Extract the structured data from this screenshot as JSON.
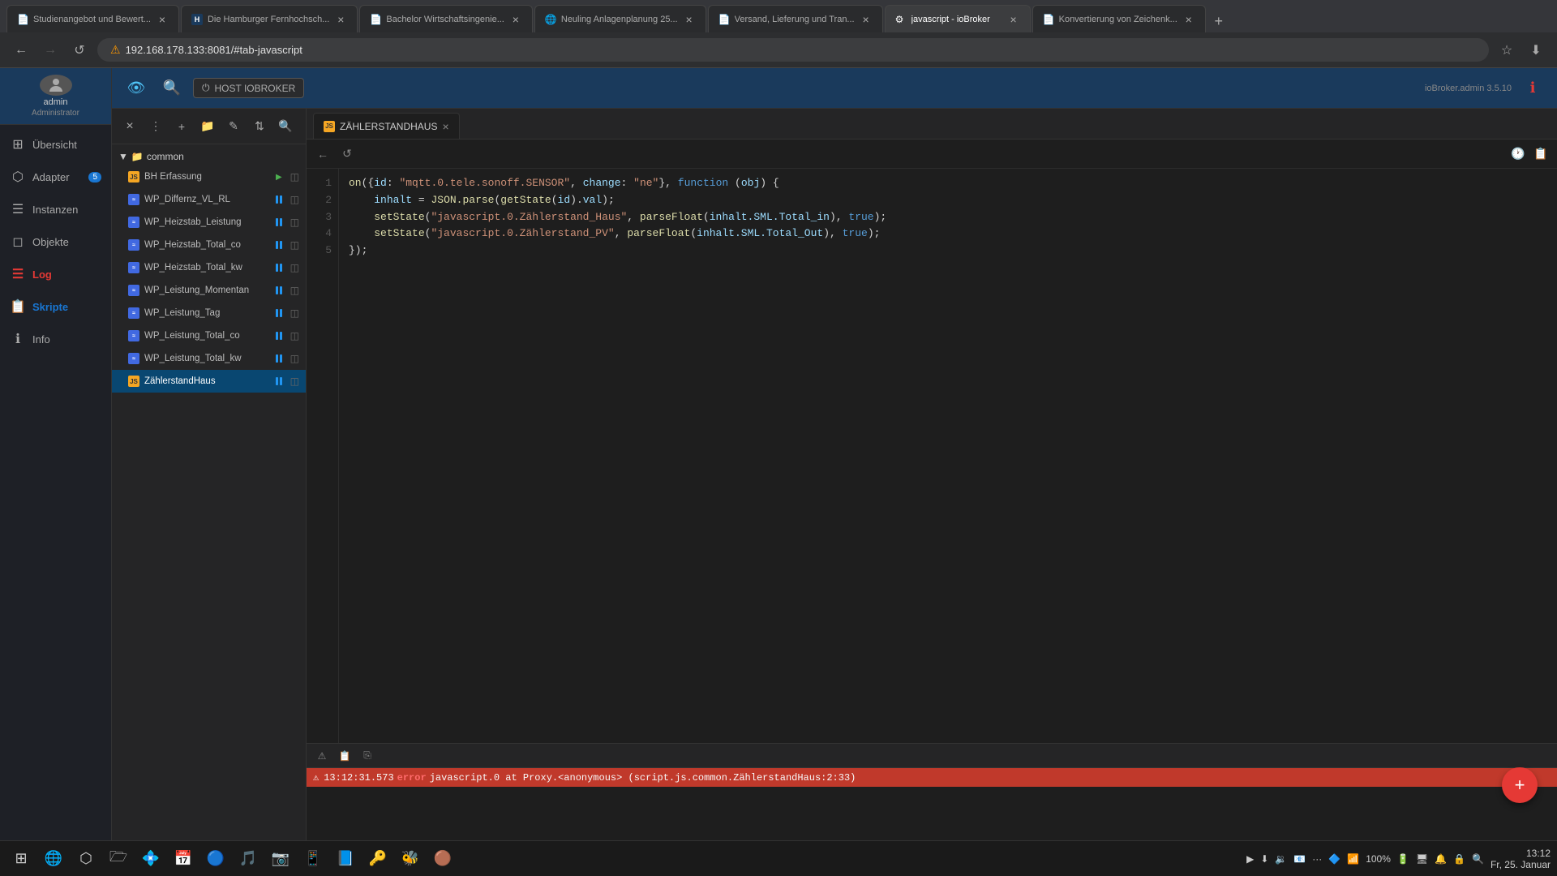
{
  "browser": {
    "tabs": [
      {
        "id": "tab-1",
        "title": "Studienangebot und Bewert...",
        "favicon": "📄",
        "active": false,
        "closable": true
      },
      {
        "id": "tab-2",
        "title": "Die Hamburger Fernhochsch...",
        "favicon": "H",
        "active": false,
        "closable": true
      },
      {
        "id": "tab-3",
        "title": "Bachelor Wirtschaftsingenie...",
        "favicon": "📄",
        "active": false,
        "closable": true
      },
      {
        "id": "tab-4",
        "title": "Neuling Anlagenplanung 25...",
        "favicon": "🌐",
        "active": false,
        "closable": true
      },
      {
        "id": "tab-5",
        "title": "Versand, Lieferung und Tran...",
        "favicon": "📄",
        "active": false,
        "closable": true
      },
      {
        "id": "tab-6",
        "title": "javascript - ioBroker",
        "favicon": "⚙",
        "active": true,
        "closable": true
      },
      {
        "id": "tab-7",
        "title": "Konvertierung von Zeichenk...",
        "favicon": "📄",
        "active": false,
        "closable": true
      }
    ],
    "address": "192.168.178.133:8081/#tab-javascript",
    "warning": true
  },
  "iobroker": {
    "version": "ioBroker.admin 3.5.10",
    "host_btn": "HOST IOBROKER",
    "nav": [
      {
        "id": "uebersicht",
        "label": "Übersicht",
        "icon": "⊞",
        "active": false
      },
      {
        "id": "adapter",
        "label": "Adapter",
        "icon": "⬡",
        "badge": "5",
        "active": false
      },
      {
        "id": "instanzen",
        "label": "Instanzen",
        "icon": "☰",
        "active": false
      },
      {
        "id": "objekte",
        "label": "Objekte",
        "icon": "◻",
        "active": false
      },
      {
        "id": "log",
        "label": "Log",
        "icon": "☰",
        "active": true,
        "color": "red"
      },
      {
        "id": "skripte",
        "label": "Skripte",
        "icon": "📋",
        "active": true,
        "color": "blue"
      },
      {
        "id": "info",
        "label": "Info",
        "icon": "ℹ",
        "active": false
      }
    ]
  },
  "admin": {
    "name": "admin",
    "role": "Administrator"
  },
  "script_panel": {
    "toolbar": {
      "menu_icon": "⋮",
      "add_icon": "+",
      "add_folder_icon": "📁",
      "edit_icon": "✎",
      "sort_icon": "⇅",
      "search_icon": "🔍"
    },
    "folder": {
      "name": "common",
      "expanded": true
    },
    "scripts": [
      {
        "name": "BH Erfassung",
        "type": "js",
        "status": "run",
        "truncated": false
      },
      {
        "name": "WP_Differnz_VL_RL",
        "type": "eq",
        "status": "pause",
        "truncated": true
      },
      {
        "name": "WP_Heizstab_Leistung",
        "type": "eq",
        "status": "pause",
        "truncated": true
      },
      {
        "name": "WP_Heizstab_Total_co",
        "type": "eq",
        "status": "pause",
        "truncated": true
      },
      {
        "name": "WP_Heizstab_Total_kw",
        "type": "eq",
        "status": "pause",
        "truncated": true
      },
      {
        "name": "WP_Leistung_Momentan",
        "type": "eq",
        "status": "pause",
        "truncated": true
      },
      {
        "name": "WP_Leistung_Tag",
        "type": "eq",
        "status": "pause",
        "truncated": false
      },
      {
        "name": "WP_Leistung_Total_co",
        "type": "eq",
        "status": "pause",
        "truncated": true
      },
      {
        "name": "WP_Leistung_Total_kw",
        "type": "eq",
        "status": "pause",
        "truncated": true
      },
      {
        "name": "ZählerstandHaus",
        "type": "js",
        "status": "pause",
        "truncated": false,
        "selected": true
      }
    ]
  },
  "editor": {
    "tab_name": "ZÄHLERSTANDHAUS",
    "code_lines": [
      "on({id: \"mqtt.0.tele.sonoff.SENSOR\", change: \"ne\"}, function (obj) {",
      "    inhalt = JSON.parse(getState(id).val);",
      "    setState(\"javascript.0.Zählerstand_Haus\", parseFloat(inhalt.SML.Total_in), true);",
      "    setState(\"javascript.0.Zählerstand_PV\", parseFloat(inhalt.SML.Total_Out), true);",
      "});"
    ],
    "line_numbers": [
      "1",
      "2",
      "3",
      "4",
      "5"
    ]
  },
  "console": {
    "error_line": {
      "time": "13:12:31.573",
      "level": "error",
      "message": "javascript.0 at Proxy.<anonymous> (script.js.common.ZählerstandHaus:2:33)"
    },
    "icon1": "⚠",
    "icon2": "📋",
    "icon3": "⎘"
  },
  "fab": {
    "icon": "+"
  },
  "taskbar": {
    "icons": [
      "⊞",
      "🌐",
      "⬡",
      "🗁",
      "💠",
      "📅",
      "🔵",
      "🎵",
      "📷",
      "📱",
      "📘",
      "🔑",
      "🐝",
      "🟤"
    ],
    "right_items": [
      "▶",
      "⬇",
      "🔉",
      "📧",
      "···",
      "🔷",
      "📶",
      "🔋",
      "🔊",
      "🖥",
      "🔔",
      "🔒",
      "🔍"
    ],
    "clock": "Fr, 25. Januar 13:12",
    "volume": "100%"
  }
}
